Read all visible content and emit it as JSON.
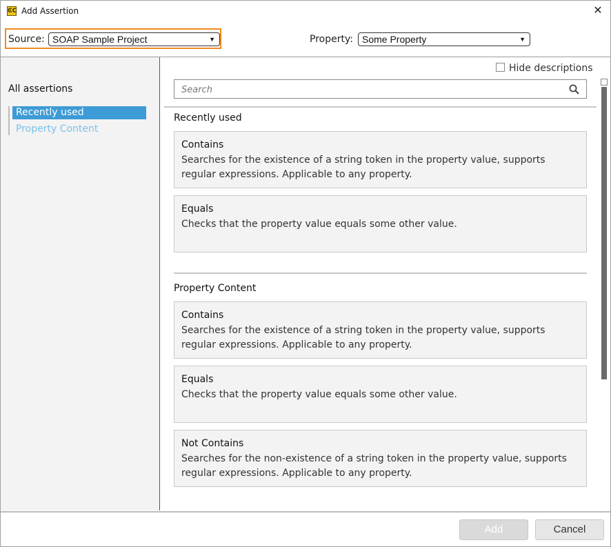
{
  "window": {
    "title": "Add Assertion",
    "close_glyph": "✕",
    "app_icon": "soapui-icon"
  },
  "header": {
    "source_label": "Source:",
    "source_value": "SOAP Sample Project",
    "property_label": "Property:",
    "property_value": "Some Property",
    "dropdown_arrow": "▼"
  },
  "sidebar": {
    "heading": "All assertions",
    "items": [
      {
        "label": "Recently used",
        "active": true
      },
      {
        "label": "Property Content",
        "active": false
      }
    ]
  },
  "main": {
    "hide_descriptions_label": "Hide descriptions",
    "hide_descriptions_checked": false,
    "search_placeholder": "Search",
    "sections": [
      {
        "title": "Recently used",
        "cards": [
          {
            "name": "Contains",
            "description": "Searches for the existence of a string token in the property value, supports regular expressions. Applicable to any property."
          },
          {
            "name": "Equals",
            "description": "Checks that the property value equals some other value."
          }
        ]
      },
      {
        "title": "Property Content",
        "cards": [
          {
            "name": "Contains",
            "description": "Searches for the existence of a string token in the property value, supports regular expressions. Applicable to any property."
          },
          {
            "name": "Equals",
            "description": "Checks that the property value equals some other value."
          },
          {
            "name": "Not Contains",
            "description": "Searches for the non-existence of a string token in the property value, supports regular expressions. Applicable to any property."
          }
        ]
      }
    ]
  },
  "footer": {
    "add_label": "Add",
    "add_enabled": false,
    "cancel_label": "Cancel"
  },
  "colors": {
    "accent": "#3d9bd6",
    "link": "#7cc0ea",
    "source_highlight": "#f0891e"
  }
}
